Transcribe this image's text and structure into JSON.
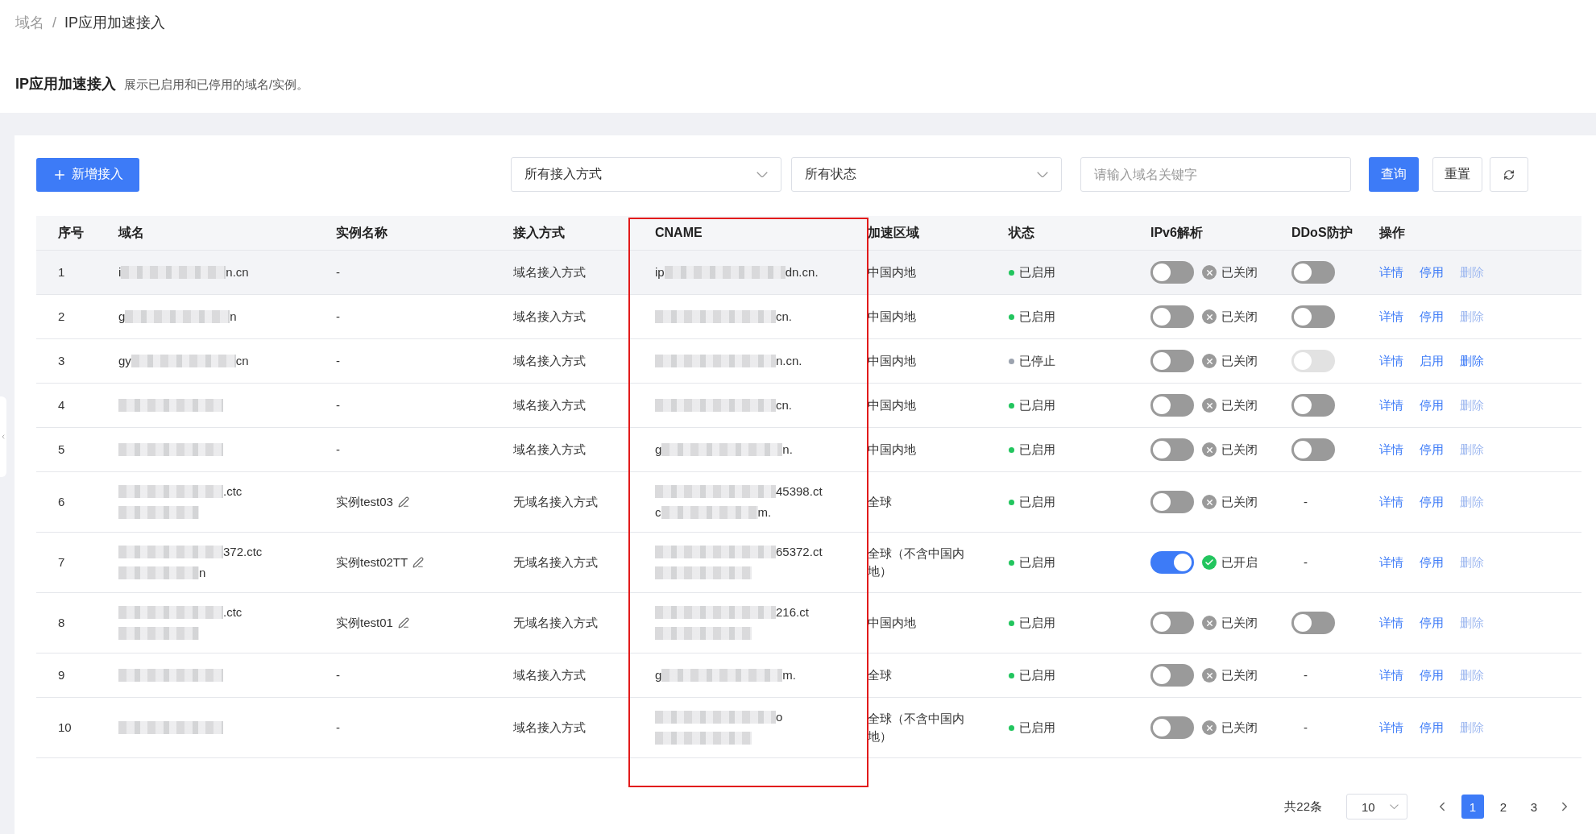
{
  "breadcrumb": {
    "separator": "/",
    "items": [
      {
        "label": "域名",
        "current": false
      },
      {
        "label": "IP应用加速接入",
        "current": true
      }
    ]
  },
  "page_header": {
    "title": "IP应用加速接入",
    "description": "展示已启用和已停用的域名/实例。"
  },
  "toolbar": {
    "add_button": "新增接入",
    "filters": [
      {
        "value": "所有接入方式"
      },
      {
        "value": "所有状态"
      }
    ],
    "search": {
      "placeholder": "请输入域名关键字"
    },
    "query_button": "查询",
    "reset_button": "重置"
  },
  "table": {
    "columns": [
      "序号",
      "域名",
      "实例名称",
      "接入方式",
      "CNAME",
      "加速区域",
      "状态",
      "IPv6解析",
      "DDoS防护",
      "操作"
    ],
    "rows": [
      {
        "index": "1",
        "highlighted": true,
        "domain": [
          {
            "start": "i",
            "blurred": true,
            "end": "n.cn"
          }
        ],
        "instance": {
          "name": "-"
        },
        "access": "域名接入方式",
        "cname": [
          {
            "start": "ip",
            "blurred": true,
            "end": "dn.cn."
          }
        ],
        "region": "中国内地",
        "status": {
          "label": "已启用",
          "color": "#22c55e"
        },
        "ipv6": {
          "on": false,
          "label": "已关闭"
        },
        "ddos": {
          "kind": "toggle",
          "on": false,
          "disabled": false
        },
        "actions": [
          {
            "label": "详情",
            "disabled": false
          },
          {
            "label": "停用",
            "disabled": false
          },
          {
            "label": "删除",
            "disabled": true
          }
        ]
      },
      {
        "index": "2",
        "highlighted": false,
        "domain": [
          {
            "start": "g",
            "blurred": true,
            "end": "n"
          }
        ],
        "instance": {
          "name": "-"
        },
        "access": "域名接入方式",
        "cname": [
          {
            "blurred": true,
            "end": "cn."
          }
        ],
        "region": "中国内地",
        "status": {
          "label": "已启用",
          "color": "#22c55e"
        },
        "ipv6": {
          "on": false,
          "label": "已关闭"
        },
        "ddos": {
          "kind": "toggle",
          "on": false,
          "disabled": false
        },
        "actions": [
          {
            "label": "详情",
            "disabled": false
          },
          {
            "label": "停用",
            "disabled": false
          },
          {
            "label": "删除",
            "disabled": true
          }
        ]
      },
      {
        "index": "3",
        "highlighted": false,
        "domain": [
          {
            "start": "gy",
            "blurred": true,
            "end": "cn"
          }
        ],
        "instance": {
          "name": "-"
        },
        "access": "域名接入方式",
        "cname": [
          {
            "blurred": true,
            "end": "n.cn."
          }
        ],
        "region": "中国内地",
        "status": {
          "label": "已停止",
          "color": "#9ca3af"
        },
        "ipv6": {
          "on": false,
          "label": "已关闭"
        },
        "ddos": {
          "kind": "toggle",
          "on": false,
          "disabled": true
        },
        "actions": [
          {
            "label": "详情",
            "disabled": false
          },
          {
            "label": "启用",
            "disabled": false
          },
          {
            "label": "删除",
            "disabled": false
          }
        ]
      },
      {
        "index": "4",
        "highlighted": false,
        "domain": [
          {
            "blurred": true
          }
        ],
        "instance": {
          "name": "-"
        },
        "access": "域名接入方式",
        "cname": [
          {
            "blurred": true,
            "end": "cn."
          }
        ],
        "region": "中国内地",
        "status": {
          "label": "已启用",
          "color": "#22c55e"
        },
        "ipv6": {
          "on": false,
          "label": "已关闭"
        },
        "ddos": {
          "kind": "toggle",
          "on": false,
          "disabled": false
        },
        "actions": [
          {
            "label": "详情",
            "disabled": false
          },
          {
            "label": "停用",
            "disabled": false
          },
          {
            "label": "删除",
            "disabled": true
          }
        ]
      },
      {
        "index": "5",
        "highlighted": false,
        "domain": [
          {
            "blurred": true
          }
        ],
        "instance": {
          "name": "-"
        },
        "access": "域名接入方式",
        "cname": [
          {
            "start": "g",
            "blurred": true,
            "end": "n."
          }
        ],
        "region": "中国内地",
        "status": {
          "label": "已启用",
          "color": "#22c55e"
        },
        "ipv6": {
          "on": false,
          "label": "已关闭"
        },
        "ddos": {
          "kind": "toggle",
          "on": false,
          "disabled": false
        },
        "actions": [
          {
            "label": "详情",
            "disabled": false
          },
          {
            "label": "停用",
            "disabled": false
          },
          {
            "label": "删除",
            "disabled": true
          }
        ]
      },
      {
        "index": "6",
        "highlighted": false,
        "domain": [
          {
            "blurred": true,
            "end": ".ctc"
          },
          {
            "blurred": true
          }
        ],
        "instance": {
          "name": "实例test03",
          "editable": true
        },
        "access": "无域名接入方式",
        "cname": [
          {
            "blurred": true,
            "end": "45398.ct"
          },
          {
            "start": "c",
            "blurred": true,
            "end": "m."
          }
        ],
        "region": "全球",
        "status": {
          "label": "已启用",
          "color": "#22c55e"
        },
        "ipv6": {
          "on": false,
          "label": "已关闭"
        },
        "ddos": {
          "kind": "text",
          "text": "-"
        },
        "actions": [
          {
            "label": "详情",
            "disabled": false
          },
          {
            "label": "停用",
            "disabled": false
          },
          {
            "label": "删除",
            "disabled": true
          }
        ]
      },
      {
        "index": "7",
        "highlighted": false,
        "domain": [
          {
            "blurred": true,
            "end": "372.ctc"
          },
          {
            "blurred": true,
            "end": "n"
          }
        ],
        "instance": {
          "name": "实例test02TT",
          "editable": true
        },
        "access": "无域名接入方式",
        "cname": [
          {
            "blurred": true,
            "end": "65372.ct"
          },
          {
            "blurred": true
          }
        ],
        "region": "全球（不含中国内地）",
        "status": {
          "label": "已启用",
          "color": "#22c55e"
        },
        "ipv6": {
          "on": true,
          "label": "已开启"
        },
        "ddos": {
          "kind": "text",
          "text": "-"
        },
        "actions": [
          {
            "label": "详情",
            "disabled": false
          },
          {
            "label": "停用",
            "disabled": false
          },
          {
            "label": "删除",
            "disabled": true
          }
        ]
      },
      {
        "index": "8",
        "highlighted": false,
        "domain": [
          {
            "blurred": true,
            "end": ".ctc"
          },
          {
            "blurred": true
          }
        ],
        "instance": {
          "name": "实例test01",
          "editable": true
        },
        "access": "无域名接入方式",
        "cname": [
          {
            "blurred": true,
            "end": "216.ct"
          },
          {
            "blurred": true
          }
        ],
        "region": "中国内地",
        "status": {
          "label": "已启用",
          "color": "#22c55e"
        },
        "ipv6": {
          "on": false,
          "label": "已关闭"
        },
        "ddos": {
          "kind": "toggle",
          "on": false,
          "disabled": false
        },
        "actions": [
          {
            "label": "详情",
            "disabled": false
          },
          {
            "label": "停用",
            "disabled": false
          },
          {
            "label": "删除",
            "disabled": true
          }
        ]
      },
      {
        "index": "9",
        "highlighted": false,
        "domain": [
          {
            "blurred": true
          }
        ],
        "instance": {
          "name": "-"
        },
        "access": "域名接入方式",
        "cname": [
          {
            "start": "g",
            "blurred": true,
            "end": "m."
          }
        ],
        "region": "全球",
        "status": {
          "label": "已启用",
          "color": "#22c55e"
        },
        "ipv6": {
          "on": false,
          "label": "已关闭"
        },
        "ddos": {
          "kind": "text",
          "text": "-"
        },
        "actions": [
          {
            "label": "详情",
            "disabled": false
          },
          {
            "label": "停用",
            "disabled": false
          },
          {
            "label": "删除",
            "disabled": true
          }
        ]
      },
      {
        "index": "10",
        "highlighted": false,
        "domain": [
          {
            "blurred": true
          }
        ],
        "instance": {
          "name": "-"
        },
        "access": "域名接入方式",
        "cname": [
          {
            "blurred": true,
            "end": "o"
          },
          {
            "blurred": true
          }
        ],
        "region": "全球（不含中国内地）",
        "status": {
          "label": "已启用",
          "color": "#22c55e"
        },
        "ipv6": {
          "on": false,
          "label": "已关闭"
        },
        "ddos": {
          "kind": "text",
          "text": "-"
        },
        "actions": [
          {
            "label": "详情",
            "disabled": false
          },
          {
            "label": "停用",
            "disabled": false
          },
          {
            "label": "删除",
            "disabled": true
          }
        ]
      }
    ]
  },
  "pagination": {
    "total": "共22条",
    "page_size": "10",
    "pages": [
      {
        "label": "1",
        "selected": true
      },
      {
        "label": "2",
        "selected": false
      },
      {
        "label": "3",
        "selected": false
      }
    ]
  }
}
